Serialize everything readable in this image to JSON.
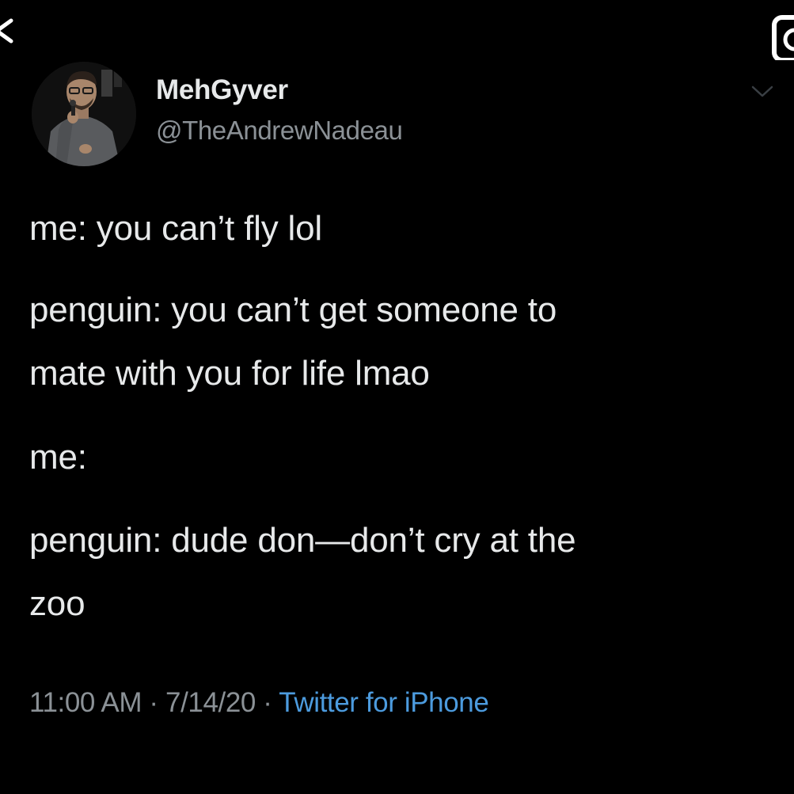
{
  "author": {
    "display_name": "MehGyver",
    "handle": "@TheAndrewNadeau"
  },
  "tweet": {
    "lines": [
      "me: you can’t fly lol",
      "penguin: you can’t get someone to",
      "mate with you for life lmao",
      "me:",
      "penguin: dude don—don’t cry at the",
      "zoo"
    ]
  },
  "meta": {
    "time": "11:00 AM",
    "separator": " · ",
    "date": "7/14/20",
    "source": "Twitter for iPhone"
  },
  "icons": {
    "back": "chevron-left-icon",
    "camera": "camera-icon",
    "more": "chevron-down-icon"
  },
  "colors": {
    "background": "#000000",
    "text": "#e7e9ea",
    "muted": "#8b9196",
    "link": "#4c9bde"
  }
}
